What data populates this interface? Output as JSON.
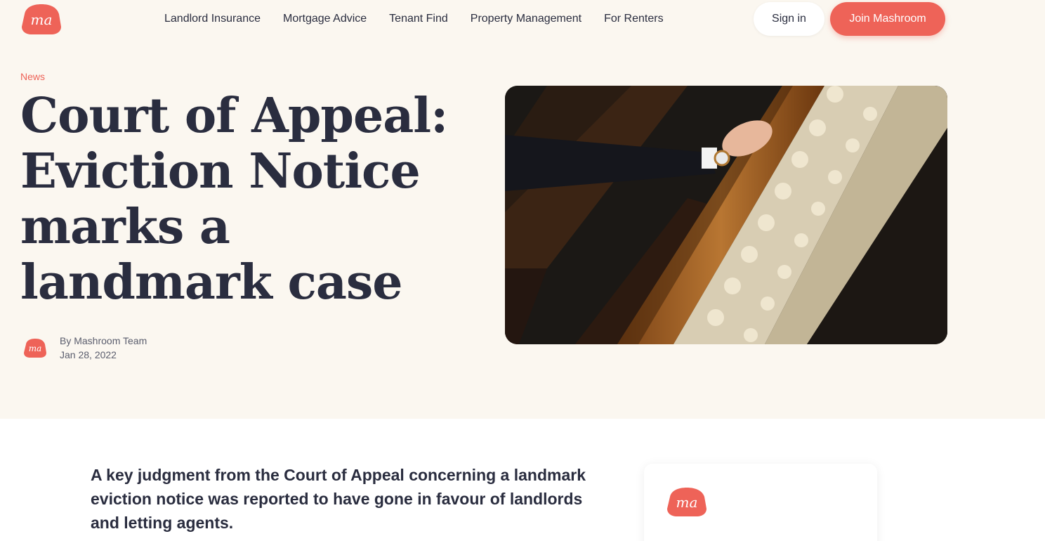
{
  "brand": {
    "logo_text": "ma",
    "accent_color": "#ee6358",
    "text_color": "#2a2d3f",
    "hero_bg": "#fbf7f0"
  },
  "nav": {
    "links": [
      {
        "label": "Landlord Insurance"
      },
      {
        "label": "Mortgage Advice"
      },
      {
        "label": "Tenant Find"
      },
      {
        "label": "Property Management"
      },
      {
        "label": "For Renters"
      }
    ],
    "sign_in_label": "Sign in",
    "join_label": "Join Mashroom"
  },
  "article": {
    "category": "News",
    "title": "Court of Appeal: Eviction Notice marks a landmark case",
    "author": "By Mashroom Team",
    "date": "Jan 28, 2022",
    "hero_image_icon": "staircase-handrail-photo",
    "lead": "A key judgment from the Court of Appeal concerning a landmark eviction notice was reported to have gone in favour of landlords and letting agents."
  }
}
